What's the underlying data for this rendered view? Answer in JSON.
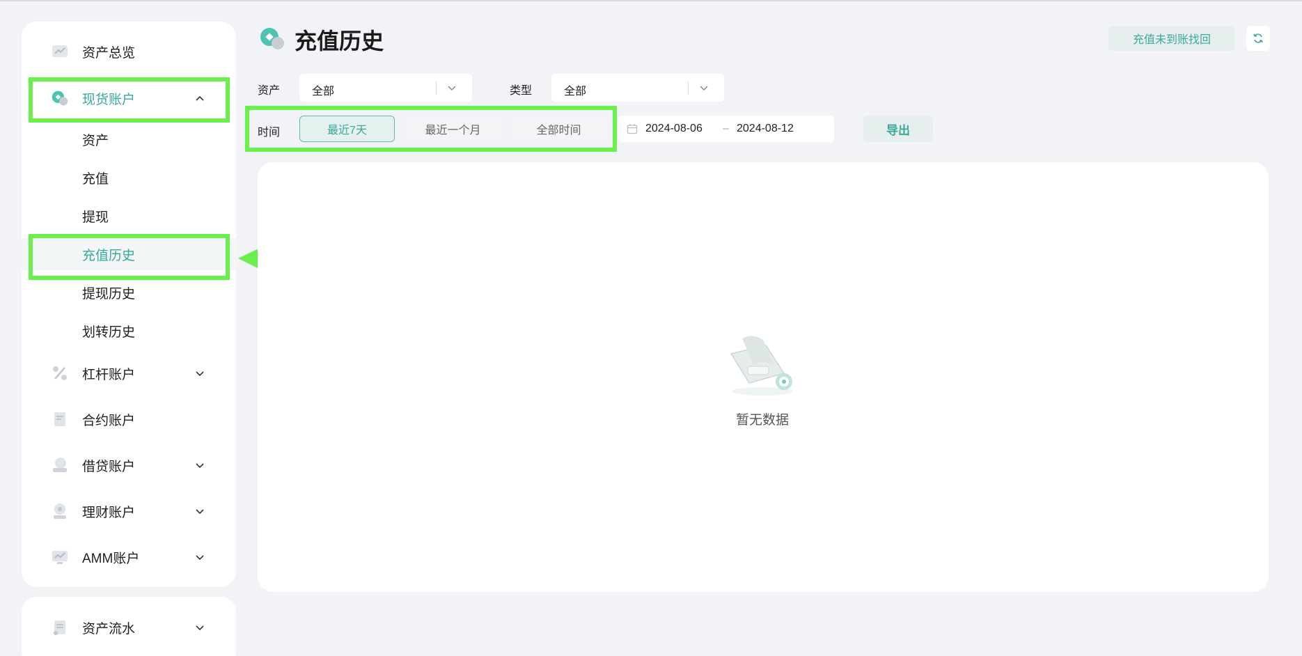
{
  "sidebar": {
    "overview_label": "资产总览",
    "spot": {
      "label": "现货账户",
      "sub": [
        "资产",
        "充值",
        "提现",
        "充值历史",
        "提现历史",
        "划转历史"
      ]
    },
    "margin_label": "杠杆账户",
    "contract_label": "合约账户",
    "loan_label": "借贷账户",
    "finance_label": "理财账户",
    "amm_label": "AMM账户",
    "flow_label": "资产流水"
  },
  "header": {
    "title": "充值历史",
    "recover_button": "充值未到账找回"
  },
  "filters": {
    "asset_label": "资产",
    "asset_value": "全部",
    "type_label": "类型",
    "type_value": "全部",
    "time_label": "时间",
    "time_options": [
      "最近7天",
      "最近一个月",
      "全部时间"
    ],
    "date_start": "2024-08-06",
    "date_sep": "–",
    "date_end": "2024-08-12",
    "export_button": "导出"
  },
  "empty": {
    "text": "暂无数据"
  },
  "colors": {
    "accent": "#3aa89a",
    "highlight": "#6bef4f",
    "background": "#f1f3f7"
  }
}
